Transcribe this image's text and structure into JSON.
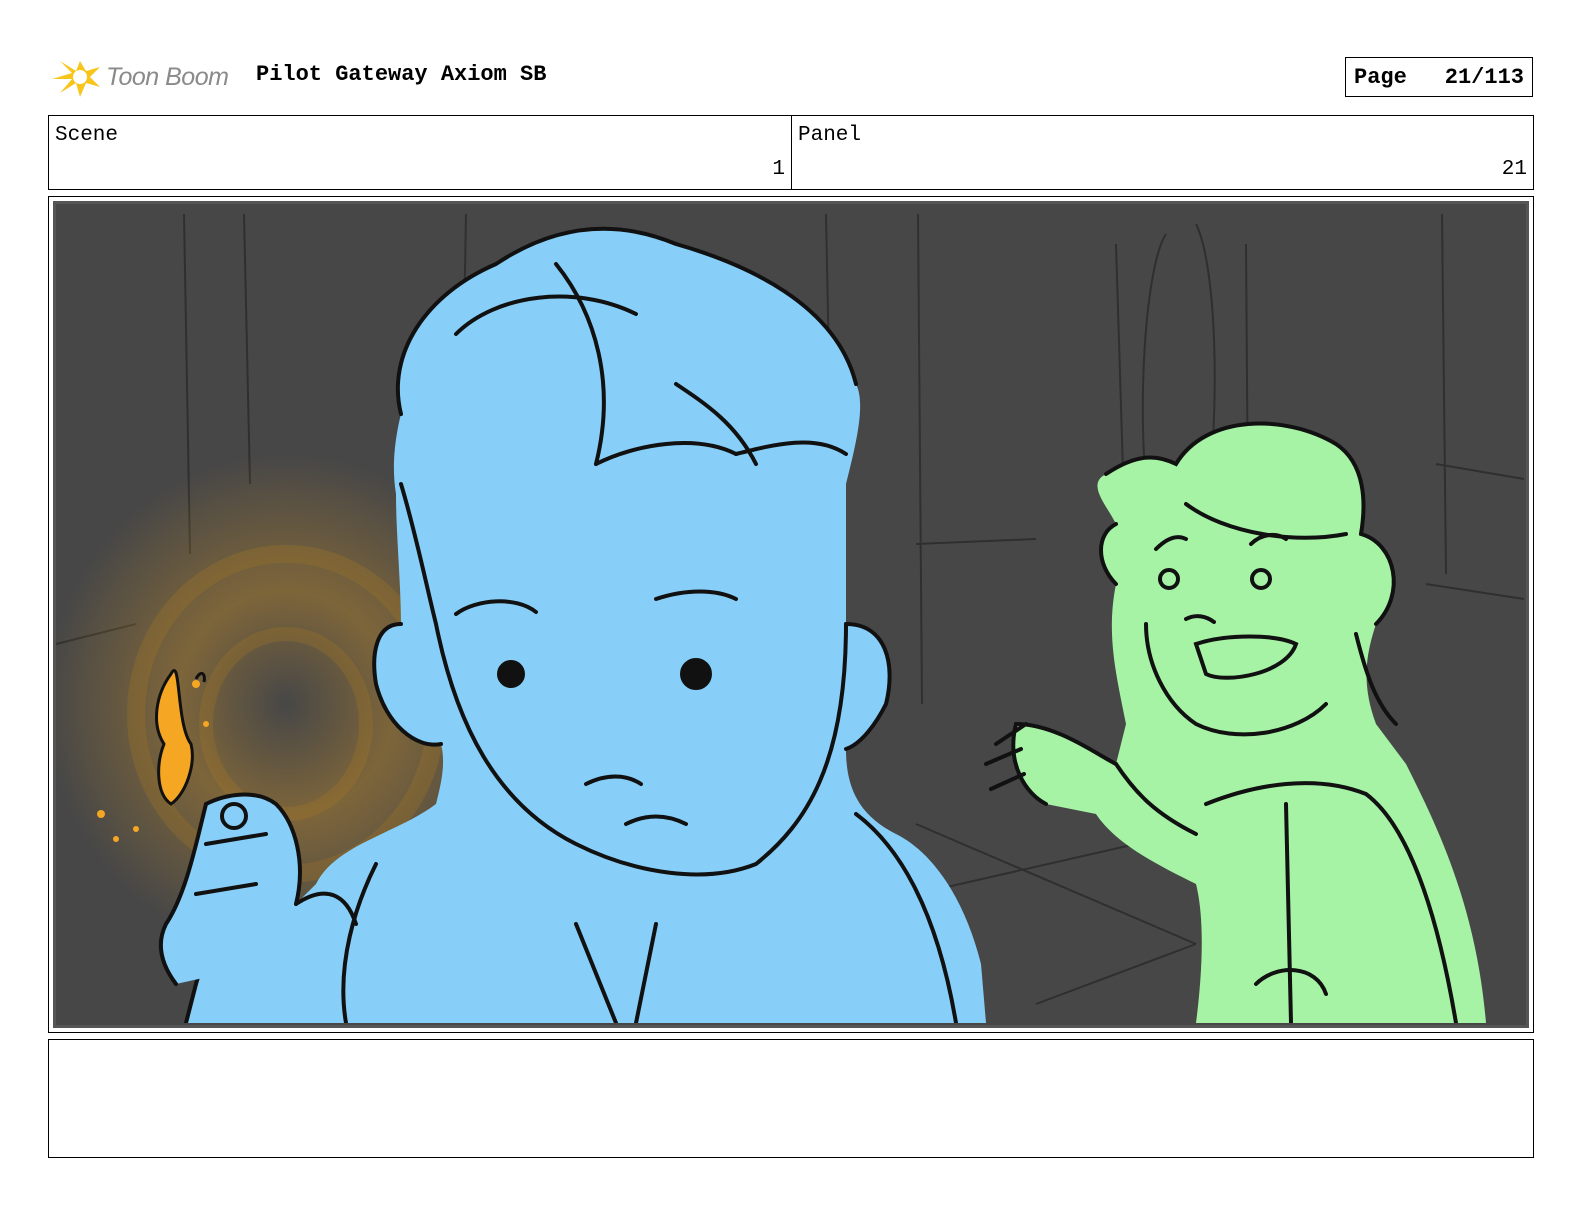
{
  "header": {
    "logo_text": "Toon Boom",
    "title": "Pilot Gateway Axiom SB",
    "page_label": "Page",
    "page_number": "21/113"
  },
  "info": {
    "scene_label": "Scene",
    "scene_value": "1",
    "panel_label": "Panel",
    "panel_value": "21"
  },
  "artwork": {
    "background_color": "#474747",
    "character_left_color": "#87cff9",
    "character_right_color": "#a6f3a6",
    "glow_color": "#c08a2a",
    "flame_color": "#f5a623"
  },
  "notes": {
    "text": ""
  }
}
